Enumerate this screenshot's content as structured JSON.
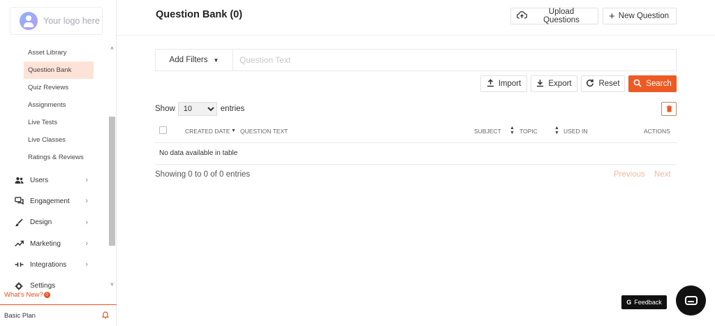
{
  "logo": {
    "text": "Your logo here"
  },
  "sidebar": {
    "sub_items": [
      {
        "label": "Asset Library",
        "active": false
      },
      {
        "label": "Question Bank",
        "active": true
      },
      {
        "label": "Quiz Reviews",
        "active": false
      },
      {
        "label": "Assignments",
        "active": false
      },
      {
        "label": "Live Tests",
        "active": false
      },
      {
        "label": "Live Classes",
        "active": false
      },
      {
        "label": "Ratings & Reviews",
        "active": false
      }
    ],
    "main_items": [
      {
        "label": "Users",
        "icon": "users-icon"
      },
      {
        "label": "Engagement",
        "icon": "chat-icon"
      },
      {
        "label": "Design",
        "icon": "brush-icon"
      },
      {
        "label": "Marketing",
        "icon": "trending-icon"
      },
      {
        "label": "Integrations",
        "icon": "plug-icon"
      },
      {
        "label": "Settings",
        "icon": "settings-icon"
      }
    ],
    "whats_new": "What's New?",
    "whats_new_badge": "0",
    "plan": "Basic Plan"
  },
  "header": {
    "title": "Question Bank (0)",
    "upload_label": "Upload Questions",
    "new_label": "New Question"
  },
  "filters": {
    "add_filters_label": "Add Filters",
    "search_placeholder": "Question Text"
  },
  "actions": {
    "import_label": "Import",
    "export_label": "Export",
    "reset_label": "Reset",
    "search_label": "Search"
  },
  "entries": {
    "show_label": "Show",
    "value": "10",
    "options": [
      "10"
    ],
    "entries_label": "entries"
  },
  "table": {
    "columns": {
      "created_date": "CREATED DATE",
      "question_text": "QUESTION TEXT",
      "subject": "SUBJECT",
      "topic": "TOPIC",
      "used_in": "USED IN",
      "actions": "ACTIONS"
    },
    "empty_text": "No data available in table",
    "showing_text": "Showing 0 to 0 of 0 entries"
  },
  "pagination": {
    "previous": "Previous",
    "next": "Next"
  },
  "feedback_label": "Feedback",
  "colors": {
    "accent": "#ee5a24",
    "active_bg": "#fde3d7"
  }
}
